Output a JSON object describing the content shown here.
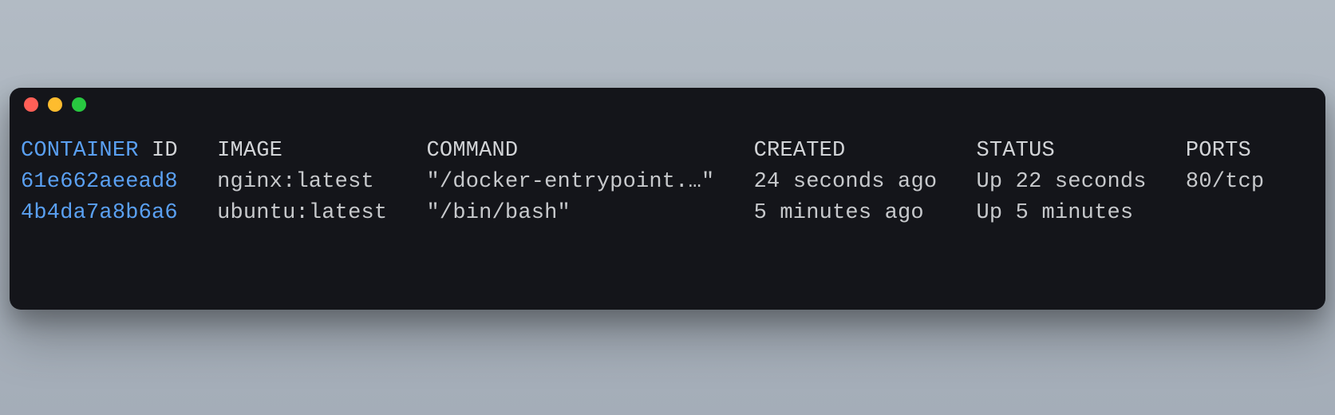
{
  "terminal": {
    "headers": {
      "container": "CONTAINER",
      "id": "ID",
      "image": "IMAGE",
      "command": "COMMAND",
      "created": "CREATED",
      "status": "STATUS",
      "ports": "PORTS"
    },
    "rows": [
      {
        "id": "61e662aeead8",
        "image": "nginx:latest",
        "command": "\"/docker-entrypoint.…\"",
        "created": "24 seconds ago",
        "status": "Up 22 seconds",
        "ports": "80/tcp"
      },
      {
        "id": "4b4da7a8b6a6",
        "image": "ubuntu:latest",
        "command": "\"/bin/bash\"",
        "created": "5 minutes ago",
        "status": "Up 5 minutes",
        "ports": ""
      }
    ],
    "colWidths": {
      "id": 15,
      "image": 16,
      "command": 25,
      "created": 17,
      "status": 16,
      "ports": 6
    }
  }
}
